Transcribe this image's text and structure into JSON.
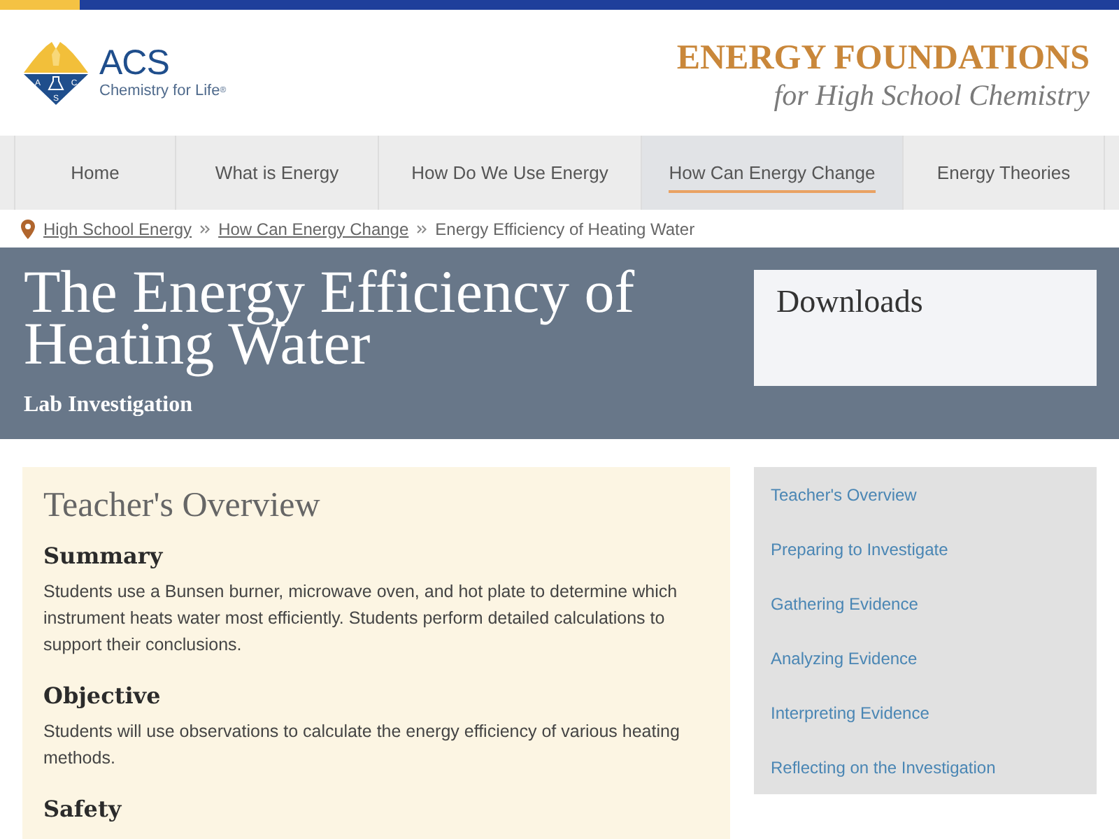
{
  "logo": {
    "emblem_letters": [
      "A",
      "C",
      "S"
    ],
    "name": "ACS",
    "tagline": "Chemistry for Life$^{®}$"
  },
  "site_title": {
    "title": "ENERGY FOUNDATIONS",
    "subtitle": "for High School Chemistry"
  },
  "nav": {
    "tabs": [
      {
        "label": "Home",
        "selected": false
      },
      {
        "label": "What is Energy",
        "selected": false
      },
      {
        "label": "How Do We Use Energy",
        "selected": false
      },
      {
        "label": "How Can Energy Change",
        "selected": true
      },
      {
        "label": "Energy Theories",
        "selected": false
      }
    ]
  },
  "breadcrumb": [
    {
      "label": "High School Energy",
      "kind": "link"
    },
    {
      "label": "How Can Energy Change",
      "kind": "link"
    },
    {
      "label": "Energy Efficiency of Heating Water",
      "kind": "current"
    }
  ],
  "banner": {
    "title": "The Energy Efficiency of Heating Water",
    "subtitle": "Lab Investigation",
    "downloads": {
      "title": "Downloads"
    }
  },
  "overview": {
    "title": "Teacher's Overview",
    "sections": [
      {
        "heading": "Summary",
        "text": "Students use a Bunsen burner, microwave oven, and hot plate to determine which instrument heats water most efficiently. Students perform detailed calculations to support their conclusions."
      },
      {
        "heading": "Objective",
        "text": "Students will use observations to calculate the energy efficiency of various heating methods."
      },
      {
        "heading": "Safety"
      }
    ]
  },
  "sidebar": {
    "links": [
      "Teacher's Overview",
      "Preparing to Investigate",
      "Gathering Evidence",
      "Analyzing Evidence",
      "Interpreting Evidence",
      "Reflecting on the Investigation"
    ]
  }
}
